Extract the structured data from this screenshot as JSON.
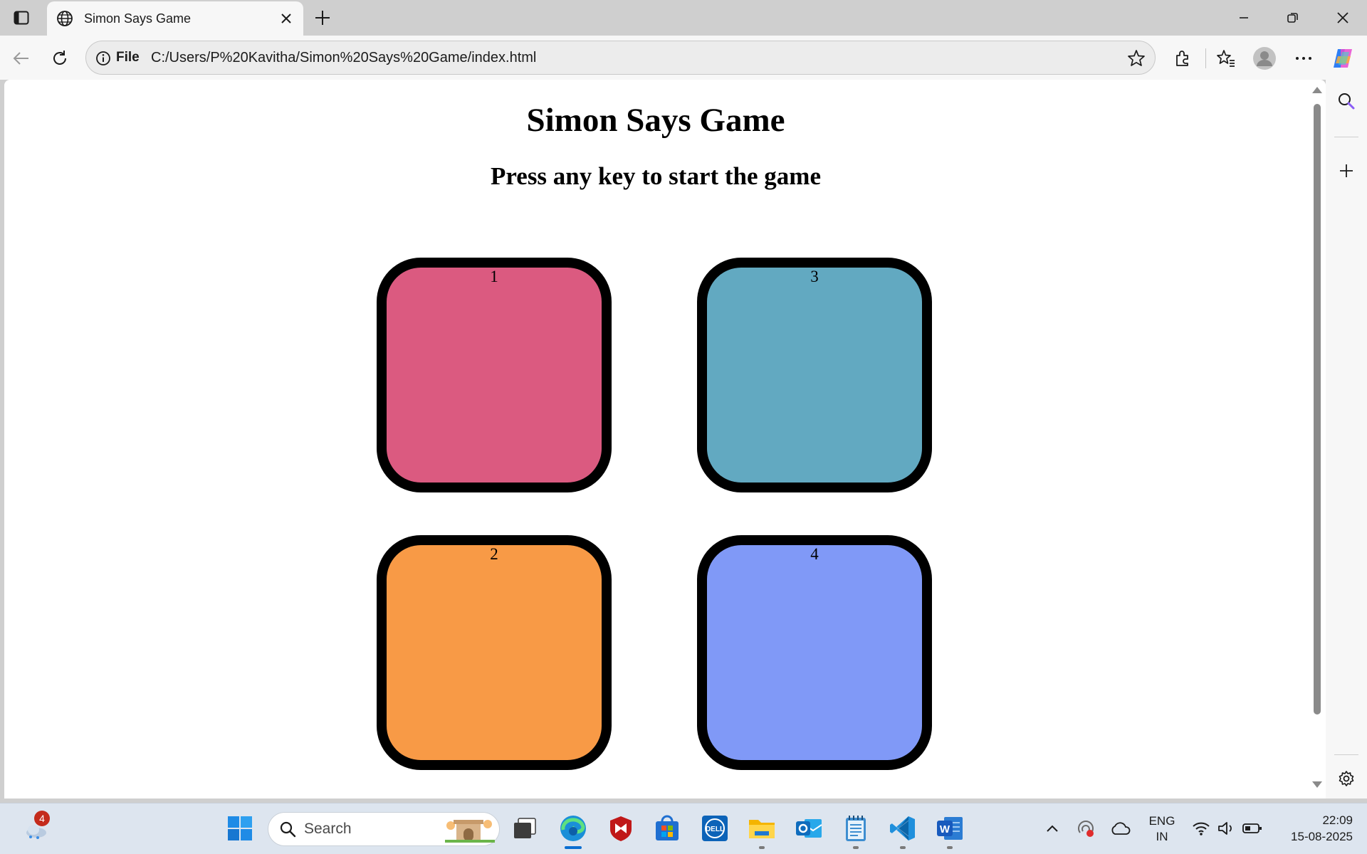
{
  "browser": {
    "tab": {
      "title": "Simon Says Game"
    },
    "address": {
      "scheme_label": "File",
      "url": "C:/Users/P%20Kavitha/Simon%20Says%20Game/index.html"
    }
  },
  "page": {
    "title": "Simon Says Game",
    "subtitle": "Press any key to start the game",
    "buttons": [
      {
        "label": "1",
        "color": "#db5a80"
      },
      {
        "label": "3",
        "color": "#62a9c1"
      },
      {
        "label": "2",
        "color": "#f89a46"
      },
      {
        "label": "4",
        "color": "#8099f7"
      }
    ]
  },
  "taskbar": {
    "notification_badge": "4",
    "search_placeholder": "Search",
    "language": {
      "line1": "ENG",
      "line2": "IN"
    },
    "clock": {
      "time": "22:09",
      "date": "15-08-2025"
    },
    "apps": [
      "weather-widget",
      "start",
      "search",
      "task-view",
      "edge",
      "mcafee",
      "microsoft-store",
      "dell",
      "file-explorer",
      "outlook",
      "notepad",
      "vscode",
      "word"
    ]
  },
  "colors": {
    "accent": "#0a6ed1",
    "chrome_bg": "#cfcfcf",
    "toolbar_bg": "#f7f7f7",
    "page_bg": "#ffffff"
  }
}
